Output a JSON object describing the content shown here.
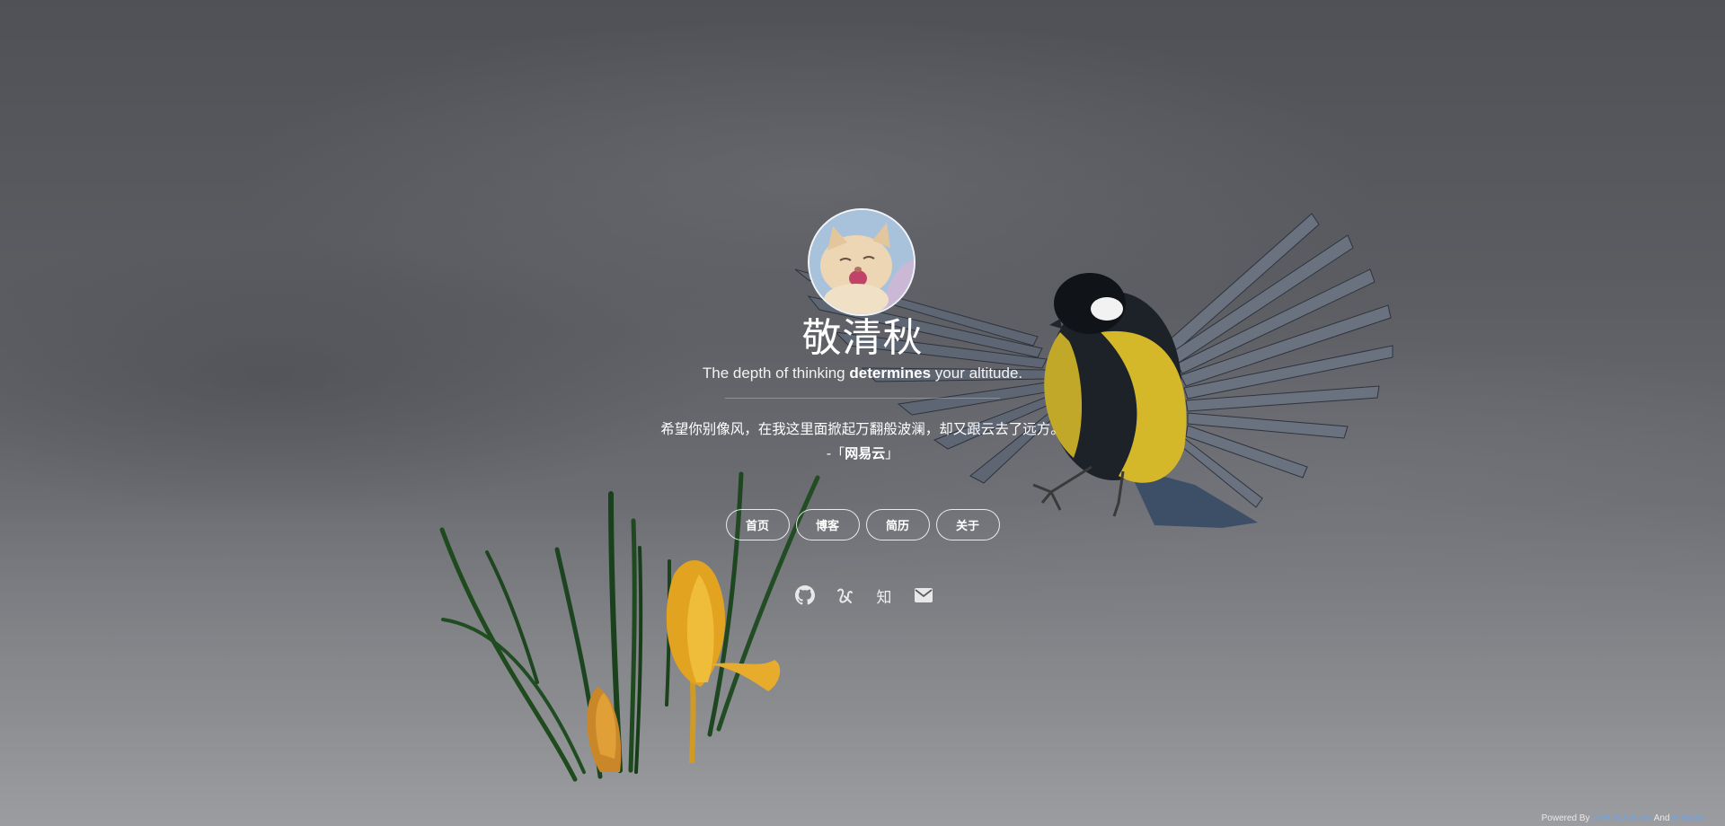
{
  "profile": {
    "name": "敬清秋",
    "tagline_pre": "The depth of thinking ",
    "tagline_bold": "determines",
    "tagline_post": " your altitude."
  },
  "quote": {
    "text": "希望你别像风，在我这里面掀起万翻般波澜，却又跟云去了远方。",
    "prefix": "-「",
    "source": "网易云",
    "suffix": "」"
  },
  "nav": {
    "home": "首页",
    "blog": "博客",
    "resume": "简历",
    "about": "关于"
  },
  "social": {
    "zhihu_glyph": "知",
    "icons": [
      "github-icon",
      "yuque-icon",
      "zhihu-icon",
      "mail-icon"
    ]
  },
  "footer": {
    "powered_by": "Powered By ",
    "actions": "GitHub Actions",
    "and": " And ",
    "hitokoto": "Hitokoto"
  },
  "colors": {
    "link": "#6fa3e6",
    "bird_yellow": "#d4b82a",
    "flower": "#e2a420"
  }
}
